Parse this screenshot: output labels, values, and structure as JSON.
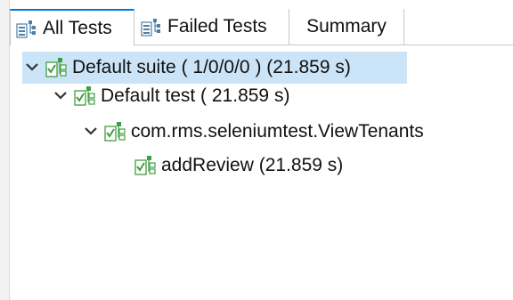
{
  "tabs": {
    "all_tests": "All Tests",
    "failed_tests": "Failed Tests",
    "summary": "Summary"
  },
  "tree": {
    "suite": "Default suite ( 1/0/0/0 ) (21.859 s)",
    "test": "Default test ( 21.859 s)",
    "class": "com.rms.seleniumtest.ViewTenants",
    "method": "addReview  (21.859 s)"
  },
  "icons": {
    "tab_icon": "test-hierarchy-icon",
    "node_icon": "test-passed-icon",
    "expand_icon": "chevron-down-icon"
  },
  "colors": {
    "selection": "#cce4f7",
    "tab_accent": "#0078d7",
    "icon_green": "#3f9f3f"
  }
}
